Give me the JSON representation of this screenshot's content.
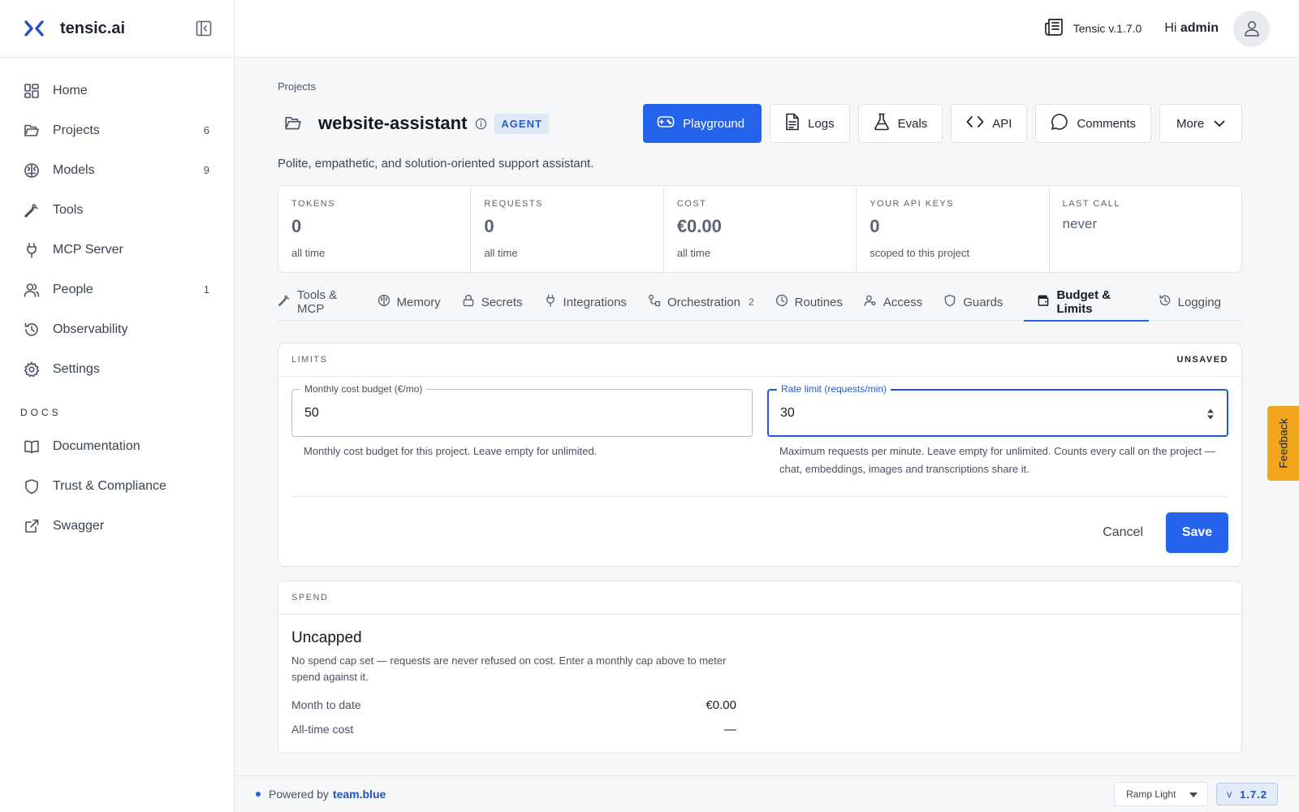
{
  "brand": {
    "name": "tensic.ai"
  },
  "sidebar": {
    "items": [
      {
        "label": "Home",
        "count": ""
      },
      {
        "label": "Projects",
        "count": "6"
      },
      {
        "label": "Models",
        "count": "9"
      },
      {
        "label": "Tools",
        "count": ""
      },
      {
        "label": "MCP Server",
        "count": ""
      },
      {
        "label": "People",
        "count": "1"
      },
      {
        "label": "Observability",
        "count": ""
      },
      {
        "label": "Settings",
        "count": ""
      }
    ],
    "docs_header": "DOCS",
    "docs_items": [
      {
        "label": "Documentation"
      },
      {
        "label": "Trust & Compliance"
      },
      {
        "label": "Swagger"
      }
    ]
  },
  "topbar": {
    "version": "Tensic v.1.7.0",
    "greeting": "Hi",
    "user": "admin"
  },
  "project": {
    "breadcrumb": "Projects",
    "title": "website-assistant",
    "badge": "AGENT",
    "description": "Polite, empathetic, and solution-oriented support assistant.",
    "actions": {
      "playground": "Playground",
      "logs": "Logs",
      "evals": "Evals",
      "api": "API",
      "comments": "Comments",
      "more": "More"
    }
  },
  "stats": [
    {
      "label": "TOKENS",
      "value": "0",
      "sub": "all time"
    },
    {
      "label": "REQUESTS",
      "value": "0",
      "sub": "all time"
    },
    {
      "label": "COST",
      "value": "€0.00",
      "sub": "all time"
    },
    {
      "label": "YOUR API KEYS",
      "value": "0",
      "sub": "scoped to this project"
    },
    {
      "label": "LAST CALL",
      "value": "never",
      "sub": ""
    }
  ],
  "tabs": [
    {
      "label": "Tools & MCP",
      "count": ""
    },
    {
      "label": "Memory",
      "count": ""
    },
    {
      "label": "Secrets",
      "count": ""
    },
    {
      "label": "Integrations",
      "count": ""
    },
    {
      "label": "Orchestration",
      "count": "2"
    },
    {
      "label": "Routines",
      "count": ""
    },
    {
      "label": "Access",
      "count": ""
    },
    {
      "label": "Guards",
      "count": ""
    },
    {
      "label": "Budget & Limits",
      "count": ""
    },
    {
      "label": "Logging",
      "count": ""
    }
  ],
  "limits": {
    "header": "LIMITS",
    "status": "UNSAVED",
    "budget": {
      "label": "Monthly cost budget (€/mo)",
      "value": "50",
      "help": "Monthly cost budget for this project. Leave empty for unlimited."
    },
    "rate": {
      "label": "Rate limit (requests/min)",
      "value": "30",
      "help": "Maximum requests per minute. Leave empty for unlimited. Counts every call on the project — chat, embeddings, images and transcriptions share it."
    },
    "cancel": "Cancel",
    "save": "Save"
  },
  "spend": {
    "header": "SPEND",
    "title": "Uncapped",
    "description": "No spend cap set — requests are never refused on cost. Enter a monthly cap above to meter spend against it.",
    "rows": [
      {
        "label": "Month to date",
        "value": "€0.00"
      },
      {
        "label": "All-time cost",
        "value": "—"
      }
    ]
  },
  "footer": {
    "powered_by": "Powered by",
    "company": "team.blue",
    "theme": "Ramp Light",
    "version_prefix": "v",
    "version": "1.7.2"
  },
  "feedback": "Feedback",
  "colors": {
    "accent": "#2563eb",
    "badge_bg": "#dfe8f7",
    "feedback": "#f2a61b"
  }
}
